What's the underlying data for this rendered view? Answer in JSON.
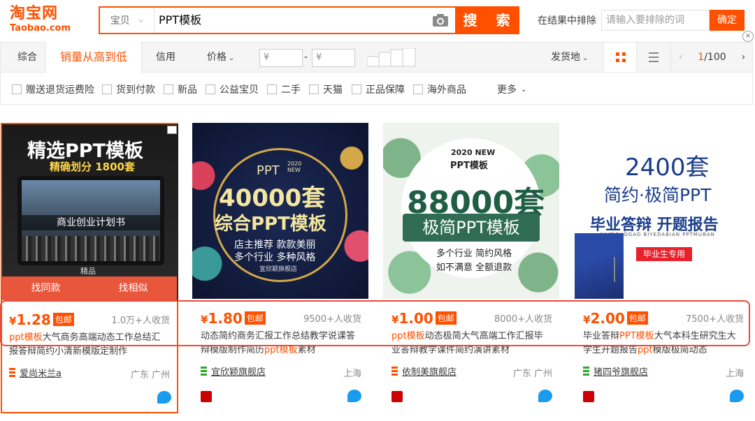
{
  "header": {
    "logo_cn": "淘宝网",
    "logo_en": "Taobao.com",
    "search_scope": "宝贝",
    "search_query": "PPT模板",
    "search_button": "搜 索",
    "exclude_label": "在结果中排除",
    "exclude_placeholder": "请输入要排除的词",
    "exclude_button": "确定"
  },
  "sort": {
    "items": [
      "综合",
      "销量从高到低",
      "信用",
      "价格"
    ],
    "price_from": "¥",
    "price_to": "¥",
    "price_sep": "-",
    "origin": "发货地",
    "page_current": "1",
    "page_total": "/100"
  },
  "filters": [
    "赠送退货运费险",
    "货到付款",
    "新品",
    "公益宝贝",
    "二手",
    "天猫",
    "正品保障",
    "海外商品"
  ],
  "filters_more": "更多",
  "hover_actions": [
    "找同款",
    "找相似"
  ],
  "products": [
    {
      "img_title": "精选PPT模板",
      "img_sub": "精确划分 1800套",
      "img_caption": "商业创业计划书",
      "img_brand": "精品",
      "price": "1.28",
      "tag": "包邮",
      "sold": "1.0万+人收货",
      "title_hl": "ppt模板",
      "title": "大气商务高端动态工作总结汇报答辩简约小清新模版定制作",
      "shop": "爱尚米兰a",
      "location": "广东 广州"
    },
    {
      "img_top": "PPT",
      "img_new": "2020 NEW",
      "img_title": "40000套",
      "img_sub": "综合PPT模板",
      "img_l1": "店主推荐 款款美丽",
      "img_l2": "多个行业 多种风格",
      "img_shop": "宜欣颖旗舰店",
      "price": "1.80",
      "tag": "包邮",
      "sold": "9500+人收货",
      "title_a": "动态简约商务汇报工作总结教学说课答辩模版制作简历",
      "title_hl": "ppt模板",
      "title_b": "素材",
      "shop": "宜欣颖旗舰店",
      "location": "上海"
    },
    {
      "img_new": "2020 NEW",
      "img_top": "PPT模板",
      "img_title": "88000套",
      "img_sub": "极简PPT模板",
      "img_l1": "多个行业 简约风格",
      "img_l2": "如不满意 全额退款",
      "price": "1.00",
      "tag": "包邮",
      "sold": "8000+人收货",
      "title_hl": "ppt模板",
      "title": "动态极简大气高端工作汇报毕业答辩教学课件简约演讲素材",
      "shop": "依制美旗舰店",
      "location": "广东 广州"
    },
    {
      "img_title": "2400套",
      "img_sub": "简约·极简PPT",
      "img_l1": "毕业答辩 开题报告",
      "img_pinyin": "KAITIBAOGAO BIYEDABIAN PPTMUBAN",
      "img_badge": "毕业生专用",
      "price": "2.00",
      "tag": "包邮",
      "sold": "7500+人收货",
      "title_a": "毕业答辩",
      "title_hl": "PPT模板",
      "title_b": "大气本科生研究生大学生开题报告",
      "title_hl2": "ppt",
      "title_c": "模版极简动态",
      "shop": "猪四爷旗舰店",
      "location": "上海"
    }
  ],
  "currency": "¥"
}
